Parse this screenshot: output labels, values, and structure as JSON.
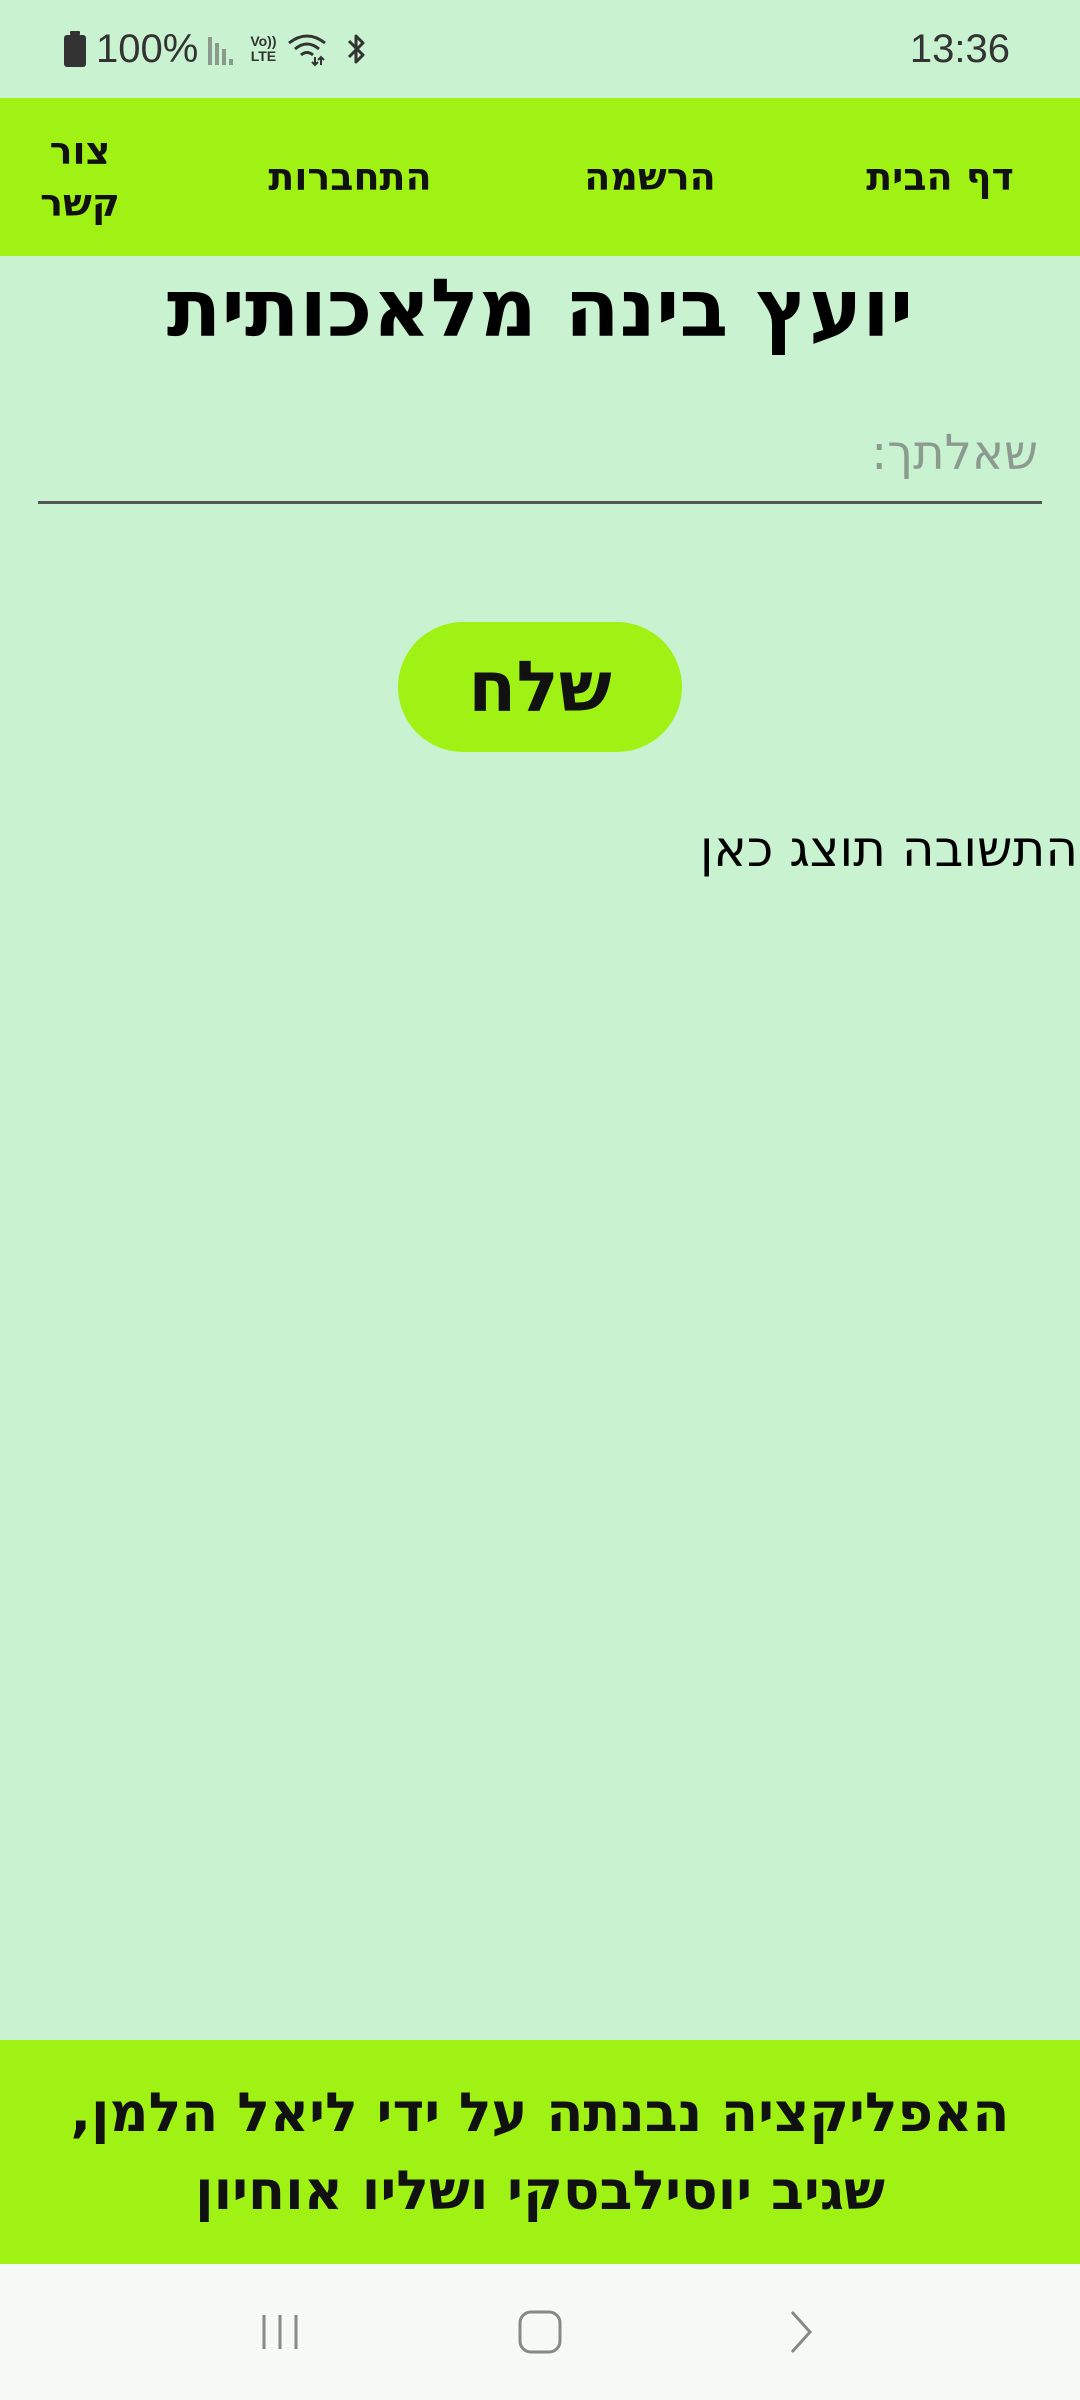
{
  "status_bar": {
    "battery": "100%",
    "time": "13:36",
    "icons": [
      "battery-icon",
      "signal-icon",
      "volte-icon",
      "wifi-icon",
      "bluetooth-icon"
    ],
    "volte_label": "Vo)) LTE"
  },
  "nav": {
    "home": "דף הבית",
    "register": "הרשמה",
    "login": "התחברות",
    "contact": "צור קשר"
  },
  "title": "יועץ בינה מלאכותית",
  "question": {
    "placeholder": "שאלתך:",
    "value": ""
  },
  "send_label": "שלח",
  "answer_text": "התשובה תוצג כאן",
  "footer_text": "האפליקציה נבנתה על ידי ליאל הלמן, שגיב יוסילבסקי ושליו אוחיון",
  "system_nav": {
    "icons": [
      "recent-apps-icon",
      "home-icon",
      "back-icon"
    ]
  },
  "colors": {
    "background": "#c9f2d0",
    "accent": "#9ff213"
  }
}
